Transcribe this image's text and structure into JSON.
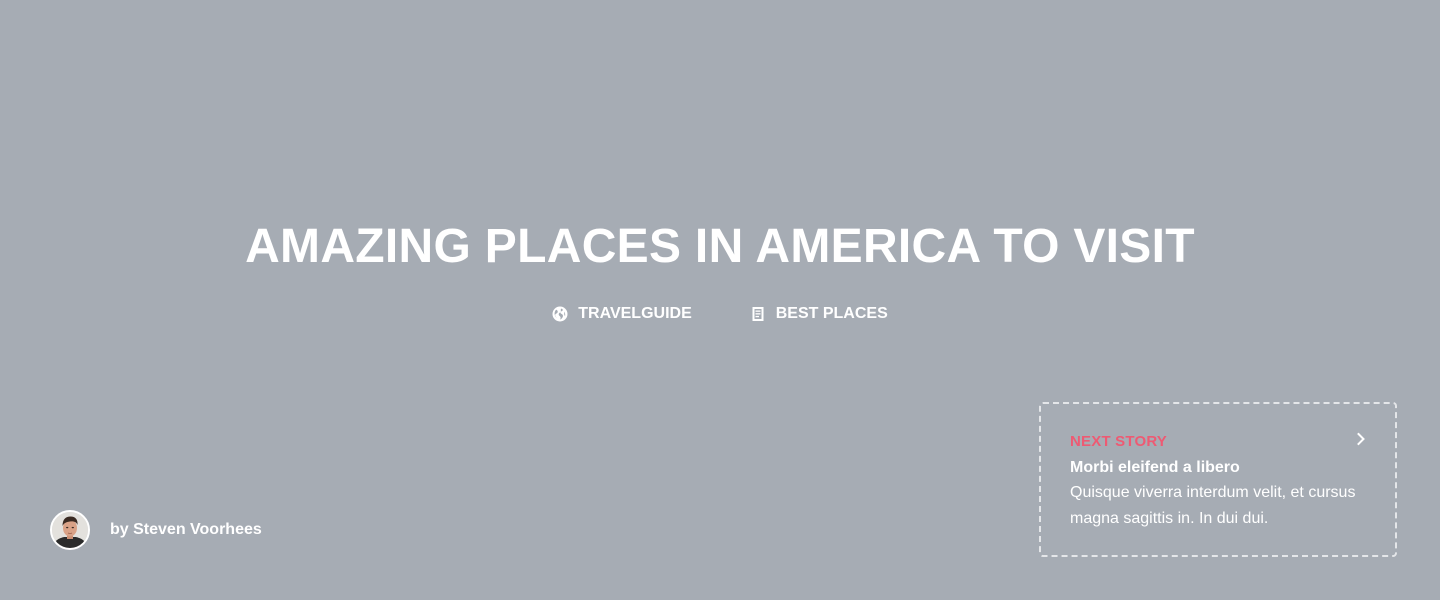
{
  "article": {
    "title": "AMAZING PLACES IN AMERICA TO VISIT",
    "categories": [
      {
        "label": "TRAVELGUIDE",
        "icon": "globe-icon"
      },
      {
        "label": "BEST PLACES",
        "icon": "document-icon"
      }
    ],
    "author": "by Steven Voorhees"
  },
  "next_story": {
    "label": "NEXT STORY",
    "title": "Morbi eleifend a libero",
    "description": "Quisque viverra interdum velit, et cursus magna sagittis in. In dui dui.",
    "icon": "chevron-right-icon"
  },
  "colors": {
    "background": "#a6acb4",
    "accent": "#ee5a73",
    "text": "#ffffff"
  }
}
